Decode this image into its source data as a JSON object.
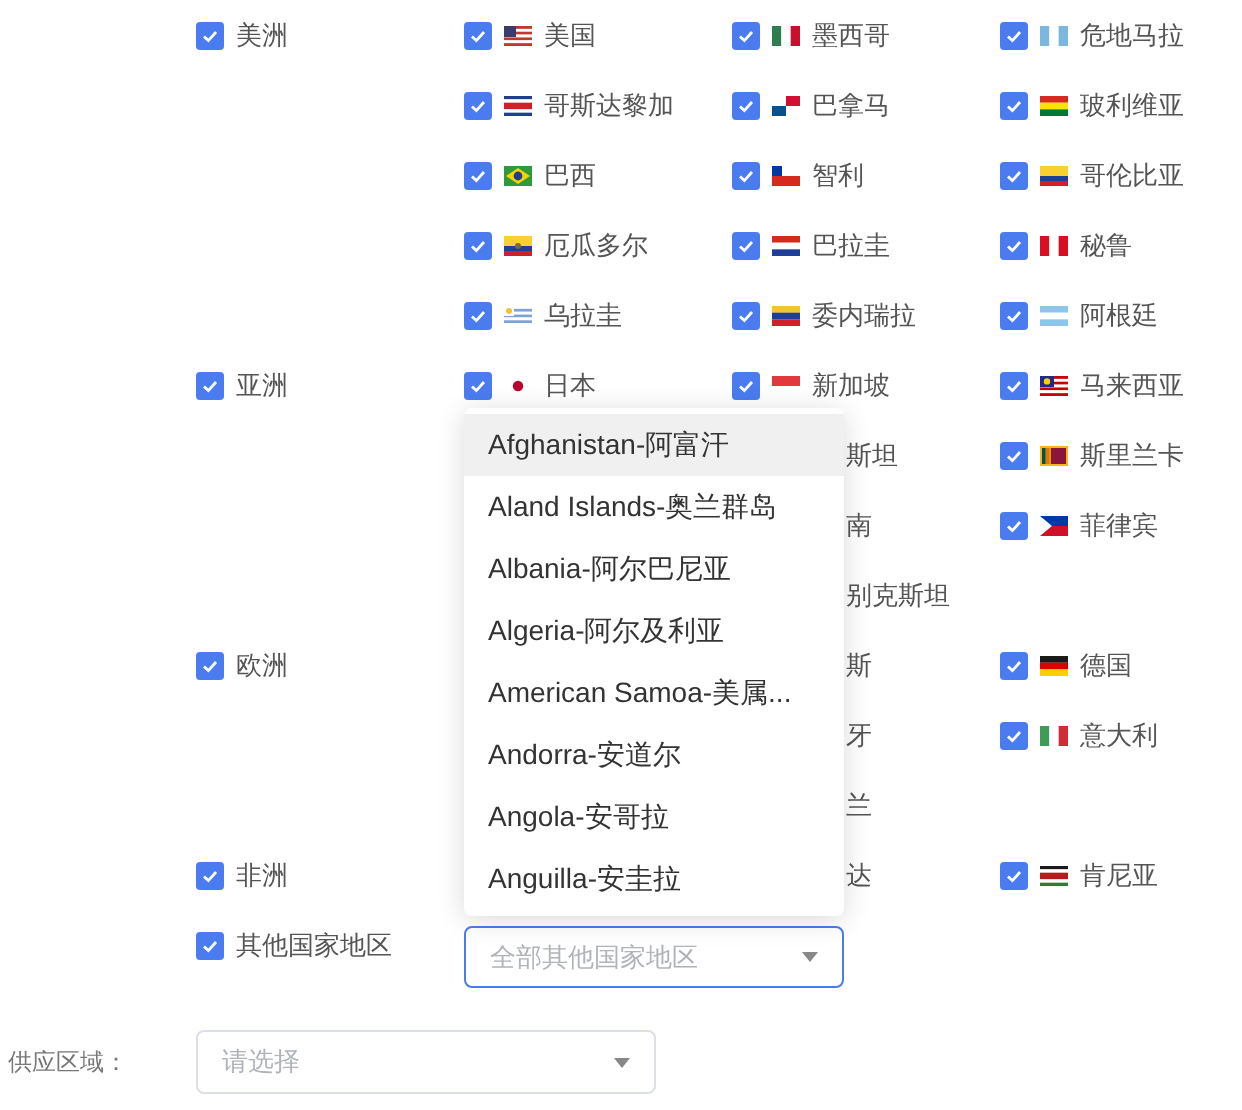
{
  "groups": [
    {
      "name": "美洲",
      "checked": true,
      "countries": [
        {
          "kind": "country",
          "name": "美国",
          "checked": true
        },
        {
          "kind": "country",
          "name": "墨西哥",
          "checked": true
        },
        {
          "kind": "country",
          "name": "危地马拉",
          "checked": true
        },
        {
          "kind": "country",
          "name": "哥斯达黎加",
          "checked": true
        },
        {
          "kind": "country",
          "name": "巴拿马",
          "checked": true
        },
        {
          "kind": "country",
          "name": "玻利维亚",
          "checked": true
        },
        {
          "kind": "country",
          "name": "巴西",
          "checked": true
        },
        {
          "kind": "country",
          "name": "智利",
          "checked": true
        },
        {
          "kind": "country",
          "name": "哥伦比亚",
          "checked": true
        },
        {
          "kind": "country",
          "name": "厄瓜多尔",
          "checked": true
        },
        {
          "kind": "country",
          "name": "巴拉圭",
          "checked": true
        },
        {
          "kind": "country",
          "name": "秘鲁",
          "checked": true
        },
        {
          "kind": "country",
          "name": "乌拉圭",
          "checked": true
        },
        {
          "kind": "country",
          "name": "委内瑞拉",
          "checked": true
        },
        {
          "kind": "country",
          "name": "阿根廷",
          "checked": true
        }
      ]
    },
    {
      "name": "亚洲",
      "checked": true,
      "countries": [
        {
          "kind": "country",
          "name": "日本",
          "checked": true
        },
        {
          "kind": "country",
          "name": "新加坡",
          "checked": true
        },
        {
          "kind": "country",
          "name": "马来西亚",
          "checked": true
        },
        {
          "kind": "blank"
        },
        {
          "kind": "fragment",
          "name": "斯坦"
        },
        {
          "kind": "country",
          "name": "斯里兰卡",
          "checked": true
        },
        {
          "kind": "blank"
        },
        {
          "kind": "fragment",
          "name": "南"
        },
        {
          "kind": "country",
          "name": "菲律宾",
          "checked": true
        },
        {
          "kind": "blank"
        },
        {
          "kind": "fragment",
          "name": "别克斯坦"
        },
        {
          "kind": "blank"
        }
      ]
    },
    {
      "name": "欧洲",
      "checked": true,
      "countries": [
        {
          "kind": "blank"
        },
        {
          "kind": "fragment",
          "name": "斯"
        },
        {
          "kind": "country",
          "name": "德国",
          "checked": true
        },
        {
          "kind": "blank"
        },
        {
          "kind": "fragment",
          "name": "牙"
        },
        {
          "kind": "country",
          "name": "意大利",
          "checked": true
        },
        {
          "kind": "blank"
        },
        {
          "kind": "fragment",
          "name": "兰"
        },
        {
          "kind": "blank"
        }
      ]
    },
    {
      "name": "非洲",
      "checked": true,
      "countries": [
        {
          "kind": "blank"
        },
        {
          "kind": "fragment",
          "name": "达"
        },
        {
          "kind": "country",
          "name": "肯尼亚",
          "checked": true
        }
      ]
    }
  ],
  "other": {
    "name": "其他国家地区",
    "checked": true,
    "select": {
      "placeholder": "全部其他国家地区",
      "open": true,
      "options": [
        {
          "label": "Afghanistan-阿富汗",
          "selected": true
        },
        {
          "label": "Aland Islands-奥兰群岛",
          "selected": false
        },
        {
          "label": "Albania-阿尔巴尼亚",
          "selected": false
        },
        {
          "label": "Algeria-阿尔及利亚",
          "selected": false
        },
        {
          "label": "American Samoa-美属...",
          "selected": false
        },
        {
          "label": "Andorra-安道尔",
          "selected": false
        },
        {
          "label": "Angola-安哥拉",
          "selected": false
        },
        {
          "label": "Anguilla-安圭拉",
          "selected": false
        }
      ]
    }
  },
  "supply_region": {
    "label": "供应区域：",
    "placeholder": "请选择"
  }
}
